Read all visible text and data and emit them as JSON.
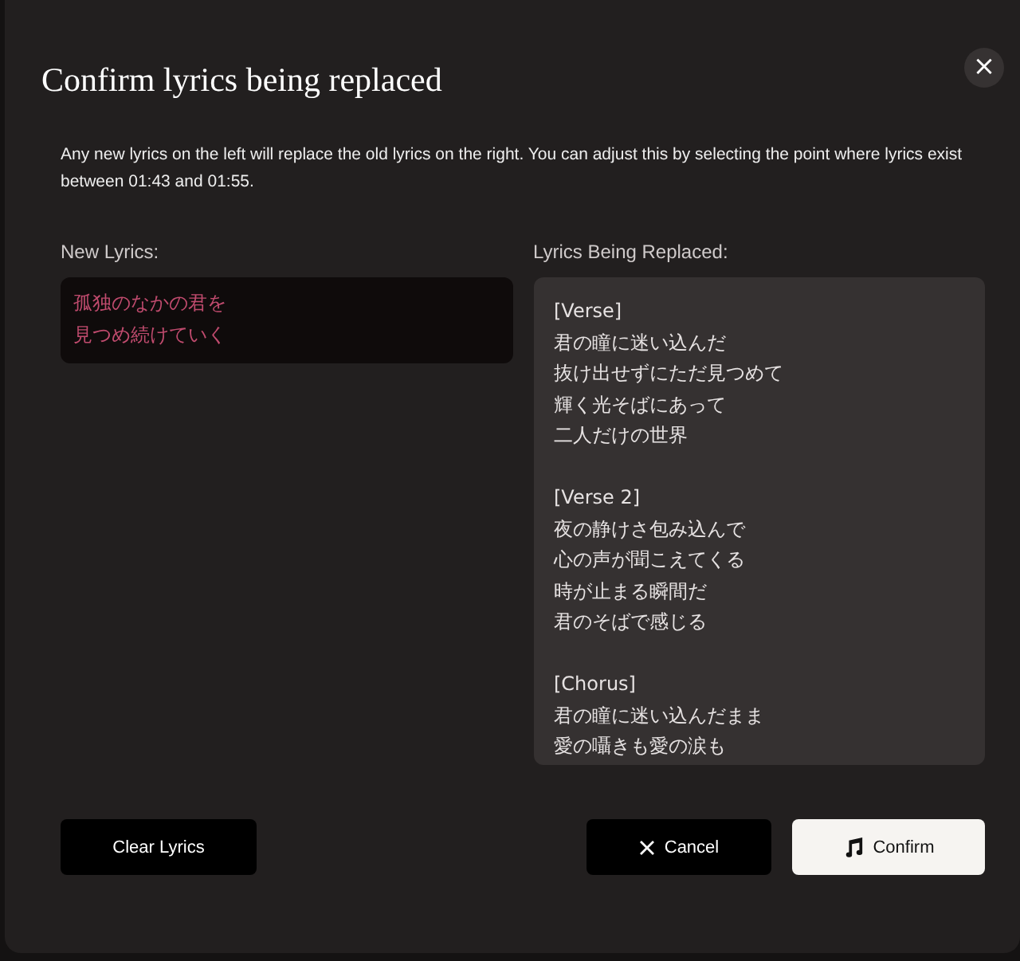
{
  "dialog": {
    "title": "Confirm lyrics being replaced",
    "close_glyph": "×",
    "description": "Any new lyrics on the left will replace the old lyrics on the right. You can adjust this by selecting the point where lyrics exist between 01:43 and 01:55."
  },
  "new_lyrics": {
    "label": "New Lyrics:",
    "lines": [
      "孤独のなかの君を",
      "見つめ続けていく"
    ]
  },
  "replaced_lyrics": {
    "label": "Lyrics Being Replaced:",
    "stanzas": [
      {
        "heading": "[Verse]",
        "lines": [
          "君の瞳に迷い込んだ",
          "抜け出せずにただ見つめて",
          "輝く光そばにあって",
          "二人だけの世界"
        ]
      },
      {
        "heading": "[Verse 2]",
        "lines": [
          "夜の静けさ包み込んで",
          "心の声が聞こえてくる",
          "時が止まる瞬間だ",
          "君のそばで感じる"
        ]
      },
      {
        "heading": "[Chorus]",
        "lines": [
          "君の瞳に迷い込んだまま",
          "愛の囁きも愛の涙も"
        ]
      }
    ]
  },
  "buttons": [
    {
      "kind": "clear",
      "label": "Clear Lyrics"
    },
    {
      "kind": "cancel",
      "label": "Cancel"
    },
    {
      "kind": "confirm",
      "label": "Confirm"
    }
  ]
}
